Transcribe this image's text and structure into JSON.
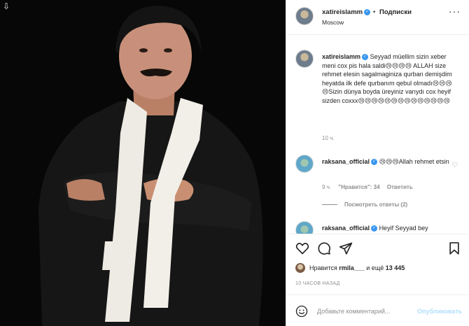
{
  "photo": {
    "back_icon": "down-arrow-icon",
    "description_icon": "portrait-photo"
  },
  "header": {
    "username": "xatireislamm",
    "separator": "•",
    "follow_label": "Подписки",
    "location": "Moscow",
    "more_icon": "more-icon",
    "more_glyph": "···"
  },
  "caption": {
    "username": "xatireislamm",
    "text": "Seyyad müellim sizin xeber meni cox pis hala saldi😢😢😢😢 ALLAH size rehmet elesin sagalmaginiza qurban demişdim heyatda ilk defe qurbanım qebul olmadı😢😢😢😢Sizin dünya boyda üreyiniz varıydı cox heyif sizden coxxx😢😢😢😢😢😢😢😢😢😢😢😢😢😢",
    "time": "10 ч."
  },
  "comments": [
    {
      "username": "raksana_official",
      "text": "😢😢😢Allah rehmet etsin",
      "time": "9 ч.",
      "likes_label": "\"Нравится\": 34",
      "reply_label": "Ответить",
      "replies_label": "Посмотреть ответы (2)"
    },
    {
      "username": "raksana_official",
      "text": "Heyif Seyyad bey"
    }
  ],
  "actions": {
    "like_icon": "heart-icon",
    "comment_icon": "comment-icon",
    "share_icon": "share-icon",
    "save_icon": "bookmark-icon"
  },
  "likes": {
    "prefix": "Нравится",
    "user": "rmila___",
    "middle": "и ещё",
    "count": "13 445"
  },
  "timestamp": "10 ЧАСОВ НАЗАД",
  "composer": {
    "placeholder": "Добавьте комментарий...",
    "publish_label": "Опубликовать",
    "emoji_icon": "smiley-icon"
  }
}
